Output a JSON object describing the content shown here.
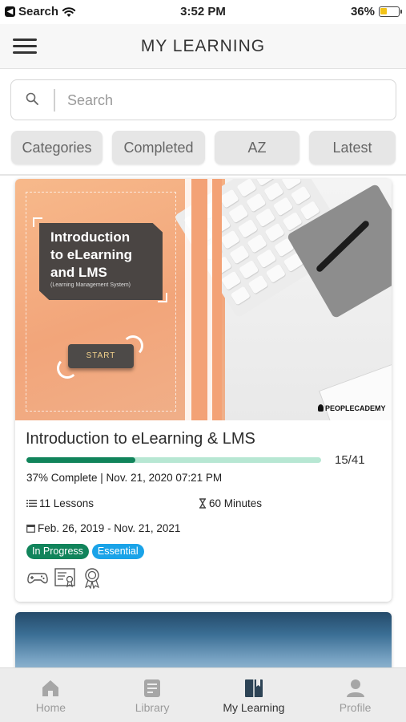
{
  "status_bar": {
    "back_label": "Search",
    "time": "3:52 PM",
    "battery": "36%",
    "battery_level": 0.36
  },
  "header": {
    "title": "MY LEARNING"
  },
  "search": {
    "placeholder": "Search"
  },
  "filters": [
    "Categories",
    "Completed",
    "AZ",
    "Latest"
  ],
  "course": {
    "thumbnail": {
      "title_lines": [
        "Introduction",
        "to eLearning",
        "and LMS"
      ],
      "subtitle": "(Learning Management System)",
      "start_label": "START",
      "brand": "PEOPLECADEMY"
    },
    "title": "Introduction to eLearning & LMS",
    "progress_percent": 37,
    "lessons_progress": "15/41",
    "complete_text": "37% Complete | Nov. 21, 2020 07:21 PM",
    "lessons": "11 Lessons",
    "minutes": "60 Minutes",
    "date_range": "Feb. 26, 2019 - Nov. 21, 2021",
    "badges": [
      {
        "label": "In Progress",
        "color": "#11845b"
      },
      {
        "label": "Essential",
        "color": "#1aa3e8"
      }
    ],
    "type_icons": [
      "gamepad-icon",
      "certificate-icon",
      "award-icon"
    ]
  },
  "tabs": [
    {
      "label": "Home",
      "icon": "home-icon",
      "active": false
    },
    {
      "label": "Library",
      "icon": "library-icon",
      "active": false
    },
    {
      "label": "My Learning",
      "icon": "my-learning-icon",
      "active": true
    },
    {
      "label": "Profile",
      "icon": "profile-icon",
      "active": false
    }
  ],
  "colors": {
    "accent": "#11845b",
    "progress_track": "#b7e7d3",
    "essential": "#1aa3e8"
  }
}
